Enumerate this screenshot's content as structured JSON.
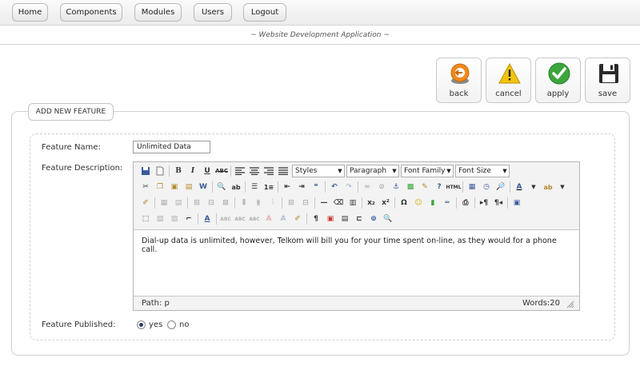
{
  "nav": {
    "items": [
      {
        "label": "Home"
      },
      {
        "label": "Components"
      },
      {
        "label": "Modules"
      },
      {
        "label": "Users"
      },
      {
        "label": "Logout"
      }
    ]
  },
  "app_title": "~ Website Development Application ~",
  "actions": {
    "back": "back",
    "cancel": "cancel",
    "apply": "apply",
    "save": "save"
  },
  "form": {
    "legend": "ADD NEW FEATURE",
    "name_label": "Feature Name:",
    "name_value": "Unlimited Data",
    "description_label": "Feature Description:",
    "published_label": "Feature Published:",
    "published_options": [
      {
        "label": "yes",
        "selected": true
      },
      {
        "label": "no",
        "selected": false
      }
    ]
  },
  "editor": {
    "dropdowns": {
      "styles": "Styles",
      "format": "Paragraph",
      "font_family": "Font Family",
      "font_size": "Font Size"
    },
    "content": "Dial-up data is unlimited, however, Telkom will bill you for your time spent on-line, as they would for a phone call.",
    "path": "Path: p",
    "word_count": "Words:20"
  },
  "colors": {
    "accent": "#2b3f6a",
    "apply_green": "#3ca53c",
    "back_orange": "#f08a1c",
    "cancel_yellow": "#f2c40f"
  }
}
